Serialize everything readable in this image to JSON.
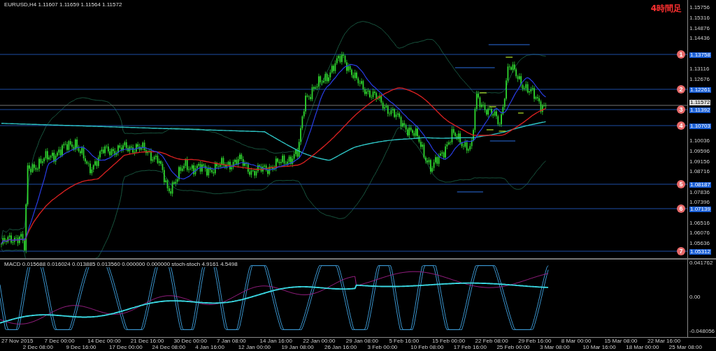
{
  "chart_header": {
    "symbol_info": "EURUSD,H4  1.11607 1.11659 1.11564 1.11572"
  },
  "timeframe_label": "4時間足",
  "price_axis": {
    "ticks": [
      "1.15756",
      "1.15316",
      "1.14876",
      "1.14436",
      "1.13116",
      "1.12676",
      "1.10036",
      "1.09596",
      "1.09156",
      "1.08716",
      "1.07836",
      "1.07396",
      "1.06516",
      "1.06076",
      "1.05636"
    ],
    "current_price": "1.11572"
  },
  "levels": [
    {
      "marker": "1",
      "price": "1.13758"
    },
    {
      "marker": "2",
      "price": "1.12261"
    },
    {
      "marker": "3",
      "price": "1.11392"
    },
    {
      "marker": "4",
      "price": "1.10703"
    },
    {
      "marker": "5",
      "price": "1.08187"
    },
    {
      "marker": "6",
      "price": "1.07139"
    },
    {
      "marker": "7",
      "price": "1.05312"
    }
  ],
  "indicator_window": {
    "info": "MACD 0.015688 0.016024 0.013885 0.013560 0.000000 0.000000  stoch-stoch 4.9161 4.5498",
    "axis_labels": [
      "0.041762",
      "0.00",
      "-0.048056"
    ]
  },
  "time_axis": {
    "labels": [
      "27 Nov 2015",
      "2 Dec 08:00",
      "7 Dec 00:00",
      "9 Dec 16:00",
      "14 Dec 00:00",
      "17 Dec 00:00",
      "21 Dec 16:00",
      "24 Dec 08:00",
      "30 Dec 00:00",
      "4 Jan 16:00",
      "7 Jan 08:00",
      "12 Jan 00:00",
      "14 Jan 16:00",
      "19 Jan 08:00",
      "22 Jan 00:00",
      "26 Jan 16:00",
      "29 Jan 08:00",
      "3 Feb 00:00",
      "5 Feb 16:00",
      "10 Feb 08:00",
      "15 Feb 00:00",
      "17 Feb 16:00",
      "22 Feb 08:00",
      "25 Feb 00:00",
      "29 Feb 16:00",
      "3 Mar 08:00",
      "8 Mar 00:00",
      "10 Mar 16:00",
      "15 Mar 08:00",
      "18 Mar 00:00",
      "22 Mar 16:00",
      "25 Mar 08:00"
    ]
  }
}
